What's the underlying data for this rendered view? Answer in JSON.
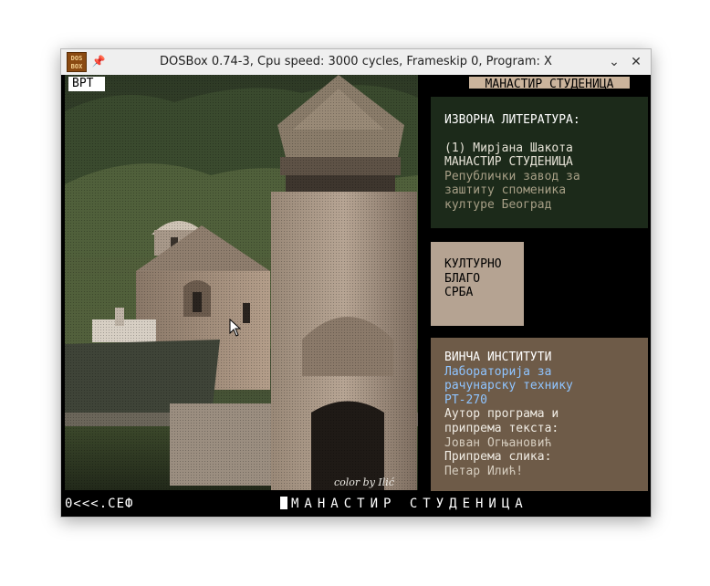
{
  "window": {
    "title": "DOSBox 0.74-3, Cpu speed:   3000 cycles, Frameskip  0, Program:        X",
    "icon_label": "DOS BOX",
    "icons": {
      "app": "dosbox-icon",
      "pin": "pin-icon",
      "minimize": "chevron-down-icon",
      "close": "close-icon"
    }
  },
  "screen": {
    "tag_vrt": "ВРТ",
    "tag_title": "МАНАСТИР СТУДЕНИЦА",
    "photo_credit": "color by Ilić",
    "sources": {
      "heading": "ИЗВОРНА ЛИТЕРАТУРА:",
      "author": "(1) Мирјана Шакота",
      "book": "МАНАСТИР СТУДЕНИЦА",
      "publisher": [
        "Републички завод за",
        "заштиту споменика",
        "културе Београд"
      ]
    },
    "heritage": {
      "lines": [
        "КУЛТУРНО",
        "БЛАГО",
        "СРБА"
      ]
    },
    "institute": {
      "name": "ВИНЧА ИНСТИТУТИ",
      "lab": [
        "Лабораторија за",
        "рачунарску технику"
      ],
      "code": "РТ-270",
      "author_label": [
        "Аутор програма и",
        "припрема текста:"
      ],
      "author_name": "Јован Огњановић",
      "images_label": "Припрема слика:",
      "images_name": "Петар Илић!"
    },
    "statusbar": {
      "left": "0<<<.СЕФ",
      "right": "МАНАСТИР СТУДЕНИЦА"
    },
    "colors": {
      "sources_bg": "#1c2a1a",
      "sources_heading": "#ffffff",
      "sources_text": "#e6e2d6",
      "sources_muted": "#a79f86",
      "heritage_bg": "#b5a392",
      "institute_bg": "#6e5b48",
      "institute_link": "#8fc4ff",
      "institute_text": "#f0ece4",
      "institute_muted": "#d6cdbf"
    }
  }
}
